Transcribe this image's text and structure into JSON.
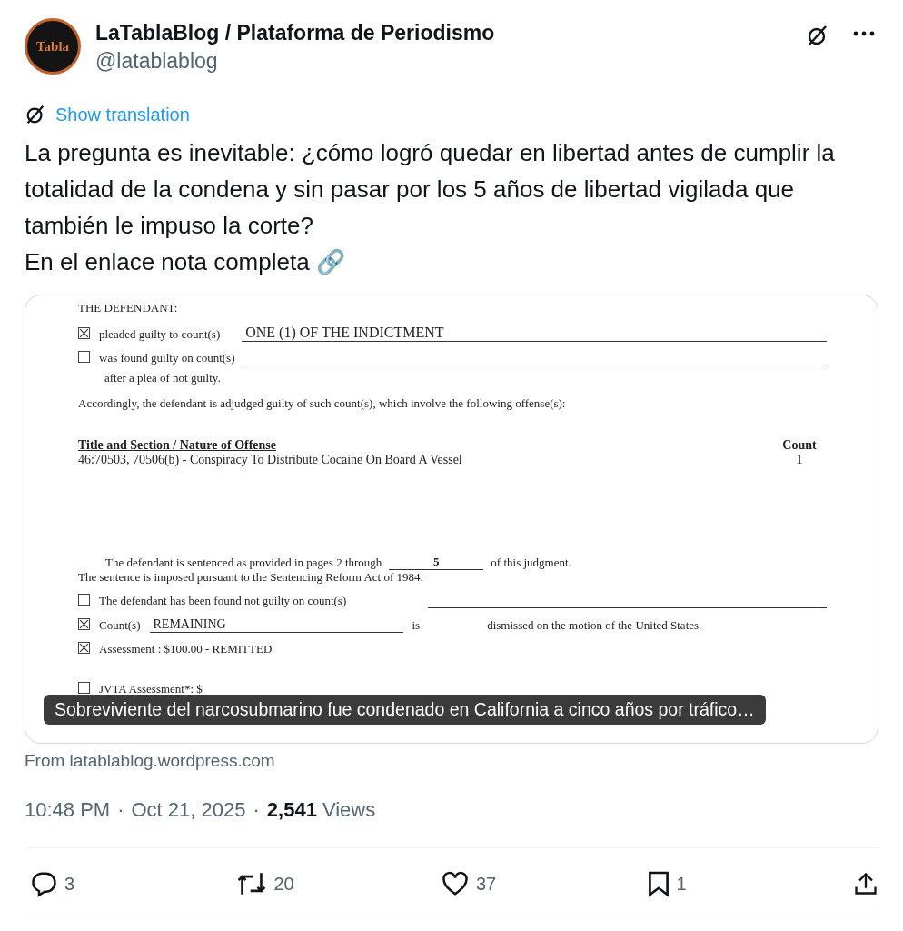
{
  "author": {
    "avatar_text": "Tabla",
    "name": "LaTablaBlog / Plataforma de Periodismo",
    "handle": "@latablablog"
  },
  "translate_link": "Show translation",
  "body": [
    "La pregunta es inevitable: ¿cómo logró quedar en libertad antes de cumplir la totalidad de la condena y sin pasar por los 5 años de libertad vigilada que también le impuso la corte?",
    "En el enlace nota completa 🔗"
  ],
  "card": {
    "document": {
      "heading": "THE DEFENDANT:",
      "plea_rows": [
        {
          "checked": true,
          "label": "pleaded guilty to count(s)",
          "value": "ONE (1) OF THE INDICTMENT"
        },
        {
          "checked": false,
          "label": "was found guilty on count(s)",
          "note": "after a plea of not guilty."
        }
      ],
      "accordingly": "Accordingly, the defendant is adjudged guilty of such count(s), which involve the following offense(s):",
      "offense_header": {
        "title": "Title and Section / Nature of Offense",
        "count": "Count"
      },
      "offense": {
        "title": "46:70503, 70506(b) - Conspiracy To Distribute Cocaine On Board A Vessel",
        "count": "1"
      },
      "sentence": {
        "before": "The defendant is sentenced as provided in pages 2 through",
        "pages": "5",
        "after": "of this judgment."
      },
      "reform_act": "The sentence is imposed pursuant to the Sentencing Reform Act of 1984.",
      "not_guilty": {
        "checked": false,
        "label": "The defendant has been found not guilty on count(s)"
      },
      "dismissed": {
        "checked": true,
        "label": "Count(s)",
        "value": "REMAINING",
        "is": "is",
        "after": "dismissed on the motion of the United States."
      },
      "assessment": {
        "checked": true,
        "label": "Assessment :  $100.00 - REMITTED"
      },
      "jvta": {
        "checked": false,
        "label": "JVTA Assessment*: $"
      }
    },
    "caption": "Sobreviviente del narcosubmarino fue condenado en California a cinco años por tráfico…"
  },
  "card_source": "From latablablog.wordpress.com",
  "meta": {
    "separator": "·",
    "time": "10:48 PM",
    "date": "Oct 21, 2025",
    "views_count": "2,541",
    "views_label": "Views"
  },
  "actions": [
    {
      "kind": "reply",
      "count": "3"
    },
    {
      "kind": "repost",
      "count": "20"
    },
    {
      "kind": "like",
      "count": "37"
    },
    {
      "kind": "bookmark",
      "count": "1"
    },
    {
      "kind": "share"
    }
  ]
}
